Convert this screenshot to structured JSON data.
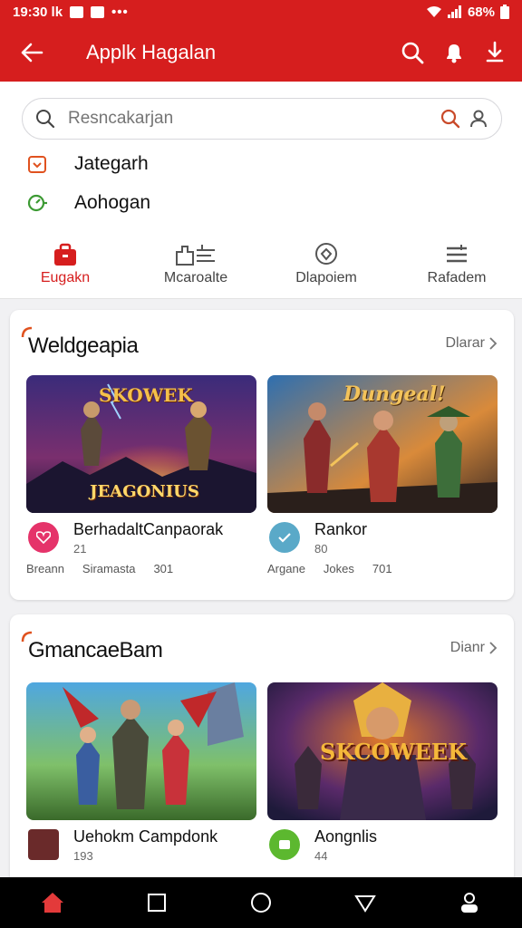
{
  "status": {
    "time": "19:30 lk",
    "battery": "68%"
  },
  "appbar": {
    "title": "Applk Hagalan"
  },
  "search": {
    "placeholder": "Resncakarjan"
  },
  "quick_links": [
    {
      "label": "Jategarh",
      "icon": "calendar-icon",
      "color": "#e0521f"
    },
    {
      "label": "Aohogan",
      "icon": "timer-icon",
      "color": "#3c9a33"
    }
  ],
  "tabs": [
    {
      "label": "Eugakn",
      "icon": "briefcase-icon",
      "active": true
    },
    {
      "label": "Mcaroalte",
      "icon": "puzzle-icon",
      "active": false
    },
    {
      "label": "Dlapoiem",
      "icon": "location-icon",
      "active": false
    },
    {
      "label": "Rafadem",
      "icon": "menu-icon",
      "active": false
    }
  ],
  "sections": [
    {
      "title": "Weldgeapia",
      "see_all": "Dlarar",
      "games": [
        {
          "thumb_title": "SKOWEK",
          "thumb_subtitle": "JEAGONIUS",
          "name": "BerhadaltCanpaorak",
          "number": "21",
          "stats": [
            "Breann",
            "Siramasta",
            "301"
          ],
          "icon": "heart-icon",
          "icon_color": "#e5336a"
        },
        {
          "thumb_title": "Dungeal!",
          "thumb_subtitle": "",
          "name": "Rankor",
          "number": "80",
          "stats": [
            "Argane",
            "Jokes",
            "701"
          ],
          "icon": "check-icon",
          "icon_color": "#5aa9c8"
        }
      ]
    },
    {
      "title": "GmancaeBam",
      "see_all": "Dianr",
      "games": [
        {
          "thumb_title": "",
          "thumb_subtitle": "",
          "name": "Uehokm Campdonk",
          "number": "193",
          "stats": [
            "",
            "",
            ""
          ],
          "icon": "avatar-icon",
          "icon_color": "#444"
        },
        {
          "thumb_title": "SKCOWEEK",
          "thumb_subtitle": "",
          "name": "Aongnlis",
          "number": "44",
          "stats": [
            "",
            "",
            ""
          ],
          "icon": "play-icon",
          "icon_color": "#5cb82f"
        }
      ]
    }
  ],
  "bottom_nav": [
    {
      "icon": "home-icon",
      "active": true
    },
    {
      "icon": "square-icon",
      "active": false
    },
    {
      "icon": "circle-icon",
      "active": false
    },
    {
      "icon": "triangle-icon",
      "active": false
    },
    {
      "icon": "profile-icon",
      "active": false
    }
  ]
}
